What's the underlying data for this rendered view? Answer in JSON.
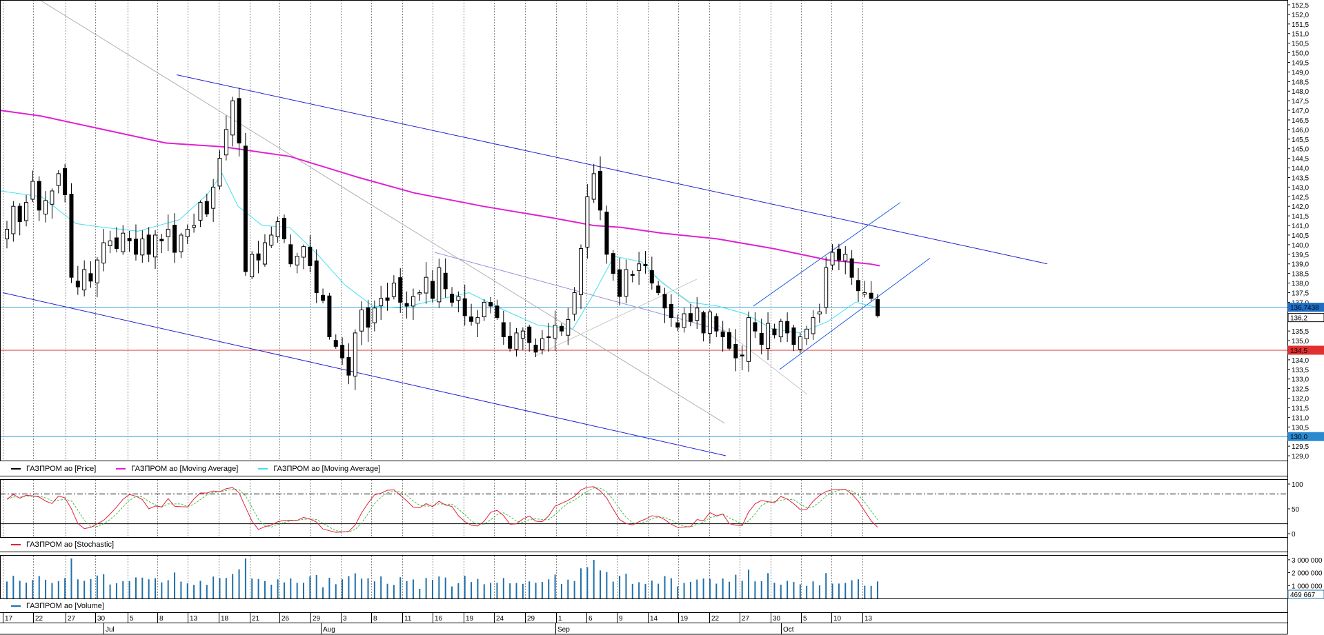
{
  "chart_data": {
    "type": "candlestick",
    "price_panel": {
      "ylim": [
        128.75,
        152.75
      ],
      "yticks": [
        "152,5",
        "152,0",
        "151,5",
        "151,0",
        "150,5",
        "150,0",
        "149,5",
        "149,0",
        "148,5",
        "148,0",
        "147,5",
        "147,0",
        "146,5",
        "146,0",
        "145,5",
        "145,0",
        "144,5",
        "144,0",
        "143,5",
        "143,0",
        "142,5",
        "142,0",
        "141,5",
        "141,0",
        "140,5",
        "140,0",
        "139,5",
        "139,0",
        "138,5",
        "138,0",
        "137,5",
        "137,0",
        "136,2",
        "135,5",
        "135,0",
        "134,0",
        "133,5",
        "133,0",
        "132,5",
        "132,0",
        "131,5",
        "131,0",
        "130,5",
        "129,5",
        "129,0"
      ],
      "tags": [
        {
          "label": "136,7438",
          "value": 136.74,
          "color": "#1f6fc8"
        },
        {
          "label": "136,2",
          "value": 136.2,
          "color": "#ffffff"
        },
        {
          "label": "134,5",
          "value": 134.5,
          "color": "#e03030"
        },
        {
          "label": "130,0",
          "value": 130.0,
          "color": "#2a8ad0"
        }
      ],
      "hlines": [
        {
          "value": 136.74,
          "color": "#3aa0e0"
        },
        {
          "value": 134.5,
          "color": "#e03030"
        },
        {
          "value": 130.0,
          "color": "#3aa0e0"
        }
      ],
      "legend": [
        {
          "name": "ГАЗПРОМ ао [Price]",
          "color": "#000000"
        },
        {
          "name": "ГАЗПРОМ ао [Moving Average]",
          "color": "#e020d0"
        },
        {
          "name": "ГАЗПРОМ ао [Moving Average]",
          "color": "#40e0f0"
        }
      ],
      "close": [
        140.8,
        142.0,
        141.2,
        142.2,
        143.3,
        141.8,
        142.3,
        142.8,
        143.7,
        142.6,
        138.3,
        137.8,
        138.7,
        138.1,
        139.2,
        140.1,
        140.2,
        139.8,
        140.6,
        140.2,
        139.5,
        140.3,
        139.5,
        140.5,
        140.2,
        140.8,
        139.6,
        140.5,
        140.8,
        141.0,
        142.2,
        141.6,
        143.0,
        144.5,
        146.0,
        147.5,
        145.3,
        138.6,
        139.5,
        139.2,
        140.1,
        140.5,
        141.2,
        140.3,
        139.0,
        139.4,
        139.9,
        138.9,
        137.5,
        137.1,
        135.2,
        134.7,
        134.1,
        133.2,
        135.4,
        136.6,
        135.7,
        136.7,
        137.2,
        137.1,
        138.0,
        137.0,
        136.8,
        137.3,
        137.5,
        138.3,
        137.2,
        138.8,
        137.7,
        137.0,
        137.3,
        136.3,
        136.0,
        136.2,
        137.0,
        136.8,
        136.2,
        135.2,
        134.6,
        135.4,
        135.5,
        134.9,
        134.4,
        135.1,
        135.2,
        135.8,
        135.5,
        136.1,
        137.5,
        139.8,
        142.5,
        143.7,
        141.8,
        139.5,
        138.5,
        137.3,
        138.7,
        138.4,
        139.0,
        138.9,
        138.0,
        137.5,
        136.7,
        136.2,
        135.7,
        136.4,
        136.0,
        136.7,
        135.4,
        136.5,
        135.5,
        135.2,
        134.6,
        134.1,
        134.2,
        136.2,
        135.5,
        134.8,
        135.9,
        135.3,
        136.0,
        135.4,
        134.8,
        135.2,
        135.6,
        136.2,
        136.5,
        138.8,
        139.6,
        139.2,
        139.5,
        138.3,
        137.6,
        137.5,
        137.2,
        136.3
      ]
    },
    "ma_slow_points": [
      [
        0,
        147.0
      ],
      [
        60,
        146.7
      ],
      [
        150,
        146.0
      ],
      [
        240,
        145.3
      ],
      [
        323,
        145.1
      ],
      [
        420,
        144.6
      ],
      [
        520,
        143.5
      ],
      [
        600,
        142.7
      ],
      [
        700,
        142.0
      ],
      [
        800,
        141.4
      ],
      [
        860,
        141.0
      ],
      [
        900,
        140.9
      ],
      [
        960,
        140.6
      ],
      [
        1040,
        140.3
      ],
      [
        1120,
        139.8
      ],
      [
        1200,
        139.2
      ],
      [
        1260,
        139.0
      ],
      [
        1275,
        138.9
      ]
    ],
    "ma_fast_points": [
      [
        0,
        142.8
      ],
      [
        60,
        142.5
      ],
      [
        110,
        141.1
      ],
      [
        150,
        140.9
      ],
      [
        200,
        140.7
      ],
      [
        260,
        141.3
      ],
      [
        300,
        142.6
      ],
      [
        322,
        143.7
      ],
      [
        345,
        142.0
      ],
      [
        380,
        141.0
      ],
      [
        420,
        140.9
      ],
      [
        460,
        139.5
      ],
      [
        500,
        137.9
      ],
      [
        540,
        136.8
      ],
      [
        580,
        136.7
      ],
      [
        630,
        137.1
      ],
      [
        680,
        137.5
      ],
      [
        730,
        136.6
      ],
      [
        780,
        135.8
      ],
      [
        830,
        135.6
      ],
      [
        860,
        137.4
      ],
      [
        890,
        139.4
      ],
      [
        930,
        139.1
      ],
      [
        960,
        138.0
      ],
      [
        1000,
        137.0
      ],
      [
        1040,
        136.8
      ],
      [
        1080,
        136.4
      ],
      [
        1120,
        135.6
      ],
      [
        1160,
        135.4
      ],
      [
        1200,
        136.0
      ],
      [
        1240,
        137.0
      ],
      [
        1275,
        136.7
      ]
    ],
    "trendlines": [
      {
        "color": "#2020d0",
        "from": [
          256,
          148.85
        ],
        "to": [
          1518,
          139.0
        ]
      },
      {
        "color": "#2020d0",
        "from": [
          4,
          137.5
        ],
        "to": [
          1052,
          129.0
        ]
      },
      {
        "color": "#2060e0",
        "from": [
          1092,
          136.8
        ],
        "to": [
          1305,
          142.2
        ]
      },
      {
        "color": "#2060e0",
        "from": [
          1130,
          133.5
        ],
        "to": [
          1348,
          139.3
        ]
      },
      {
        "color": "#b0b0b0",
        "from": [
          60,
          152.7
        ],
        "to": [
          1050,
          130.7
        ]
      },
      {
        "color": "#9090e0",
        "from": [
          630,
          139.6
        ],
        "to": [
          1050,
          135.5
        ]
      },
      {
        "color": "#c8c8c8",
        "from": [
          775,
          134.2
        ],
        "to": [
          1010,
          138.2
        ]
      },
      {
        "color": "#c8c8c8",
        "from": [
          940,
          138.6
        ],
        "to": [
          1170,
          132.2
        ]
      }
    ],
    "stochastic": {
      "ylim": [
        0,
        100
      ],
      "yticks": [
        "100",
        "50",
        "0"
      ],
      "levels": [
        80,
        20
      ],
      "legend": "ГАЗПРОМ ао [Stochastic]",
      "line_color": "#e02040",
      "signal_color": "#40c040"
    },
    "volume": {
      "yticks": [
        "3 000 000",
        "2 000 000",
        "1 000 000"
      ],
      "last_label": "469 667",
      "legend": "ГАЗПРОМ ао [Volume]",
      "color": "#1f6fa8"
    },
    "x_axis": {
      "days": [
        {
          "label": "17",
          "x": 4
        },
        {
          "label": "22",
          "x": 48
        },
        {
          "label": "27",
          "x": 95
        },
        {
          "label": "30",
          "x": 138
        },
        {
          "label": "5",
          "x": 185
        },
        {
          "label": "8",
          "x": 228
        },
        {
          "label": "13",
          "x": 272
        },
        {
          "label": "18",
          "x": 317
        },
        {
          "label": "21",
          "x": 362
        },
        {
          "label": "26",
          "x": 405
        },
        {
          "label": "29",
          "x": 450
        },
        {
          "label": "3",
          "x": 494
        },
        {
          "label": "8",
          "x": 538
        },
        {
          "label": "11",
          "x": 583
        },
        {
          "label": "16",
          "x": 627
        },
        {
          "label": "19",
          "x": 672
        },
        {
          "label": "24",
          "x": 716
        },
        {
          "label": "29",
          "x": 761
        },
        {
          "label": "1",
          "x": 806
        },
        {
          "label": "6",
          "x": 850
        },
        {
          "label": "9",
          "x": 894
        },
        {
          "label": "14",
          "x": 939
        },
        {
          "label": "19",
          "x": 983
        },
        {
          "label": "22",
          "x": 1028
        },
        {
          "label": "27",
          "x": 1072
        },
        {
          "label": "30",
          "x": 1117
        },
        {
          "label": "5",
          "x": 1161
        },
        {
          "label": "10",
          "x": 1205
        },
        {
          "label": "13",
          "x": 1250
        }
      ],
      "months": [
        {
          "label": "Jul",
          "x": 150
        },
        {
          "label": "Aug",
          "x": 465
        },
        {
          "label": "Sep",
          "x": 805
        },
        {
          "label": "Oct",
          "x": 1132
        }
      ]
    }
  }
}
